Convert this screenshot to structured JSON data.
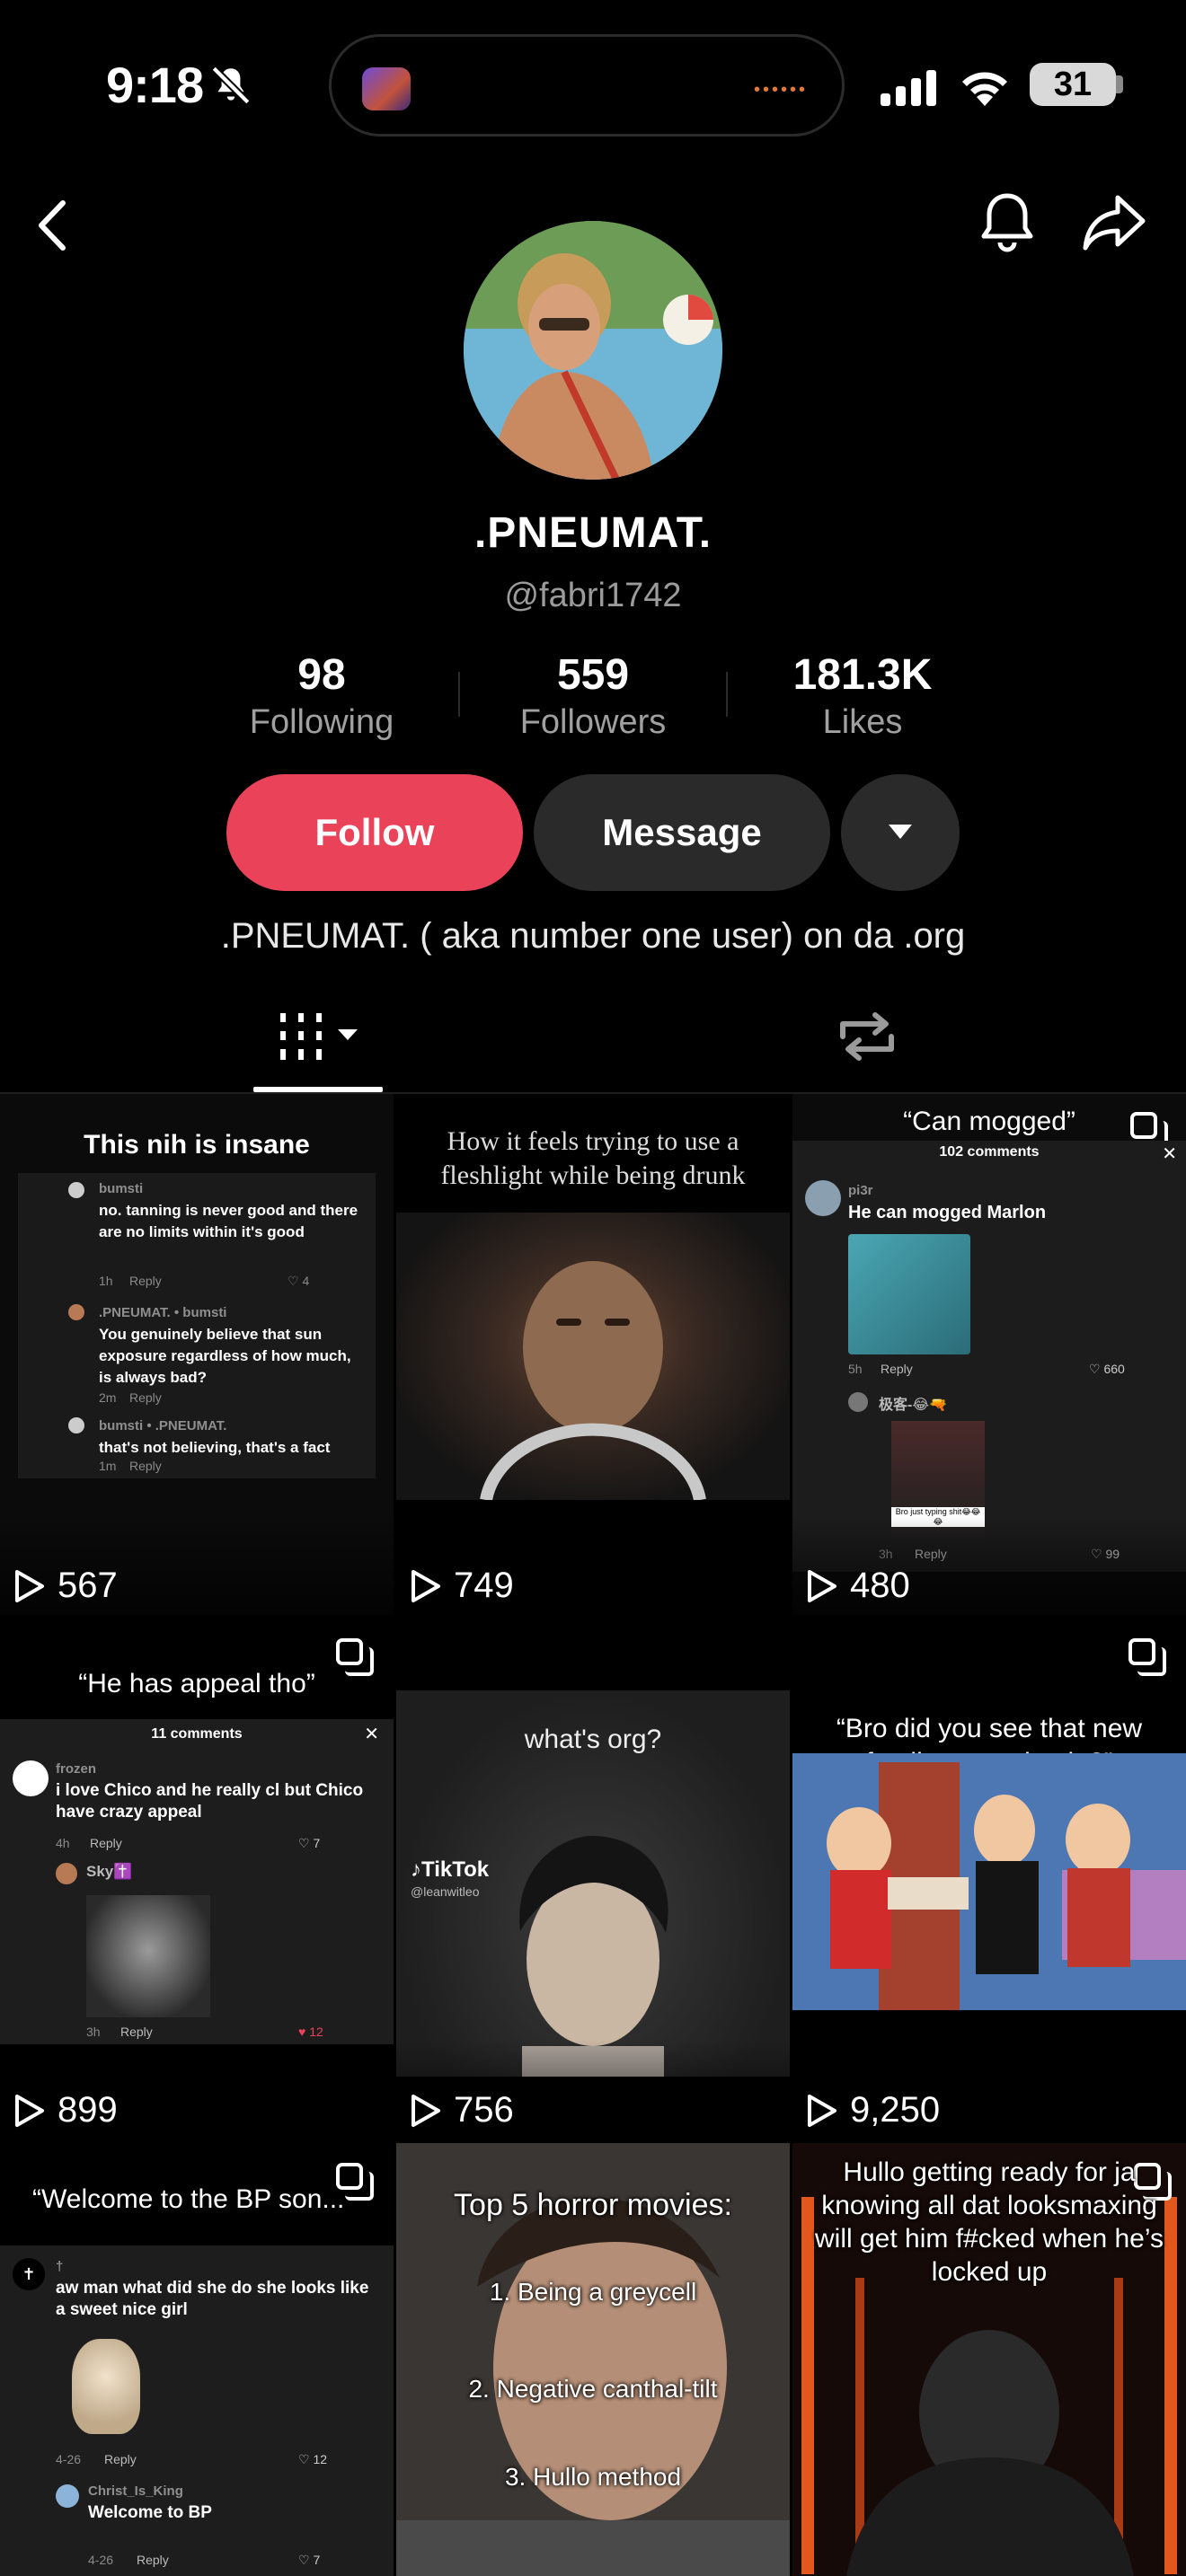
{
  "status_bar": {
    "time": "9:18",
    "battery": "31"
  },
  "profile": {
    "display_name": ".PNEUMAT.",
    "username": "@fabri1742",
    "following_count": "98",
    "following_label": "Following",
    "followers_count": "559",
    "followers_label": "Followers",
    "likes_count": "181.3K",
    "likes_label": "Likes",
    "follow_label": "Follow",
    "message_label": "Message",
    "bio": ".PNEUMAT. ( aka number one user) on da .org",
    "accent": "#ea4359"
  },
  "grid": {
    "tile1": {
      "caption": "This nih is insane",
      "comments": [
        {
          "user": "bumsti",
          "text": "no. tanning is never good and there are no limits within it's good",
          "time": "1h",
          "reply": "Reply",
          "likes": "4"
        },
        {
          "user": ".PNEUMAT. • bumsti",
          "text": "You genuinely believe that sun exposure regardless of how much, is always bad?",
          "time": "2m",
          "reply": "Reply"
        },
        {
          "user": "bumsti • .PNEUMAT.",
          "text": "that's not believing, that's a fact",
          "time": "1m",
          "reply": "Reply"
        }
      ],
      "views": "567"
    },
    "tile2": {
      "caption": "How it feels trying to use a fleshlight while being drunk",
      "views": "749"
    },
    "tile3": {
      "caption": "“Can mogged”",
      "comments_count": "102 comments",
      "comment_user": "pi3r",
      "comment_text": "He can mogged Marlon",
      "comment_time": "5h",
      "reply": "Reply",
      "likes1": "660",
      "reply_user": "极客-😂🔫",
      "reply_time": "3h",
      "likes2": "99",
      "sticker_text": "Bro just typing shit😂😂😂",
      "views": "480"
    },
    "tile4": {
      "caption": "“He has appeal tho”",
      "comments_count": "11 comments",
      "comment_user": "frozen",
      "comment_text": "i love Chico and he really cl but Chico have crazy appeal",
      "comment_time": "4h",
      "reply": "Reply",
      "likes1": "7",
      "reply_user": "Sky✝️",
      "reply_time": "3h",
      "likes2": "12",
      "views": "899"
    },
    "tile5": {
      "caption": "what's org?",
      "watermark": "TikTok",
      "handle": "@leanwitleo",
      "views": "756"
    },
    "tile6": {
      "caption": "“Bro did you see that new family guy episode?”",
      "views": "9,250"
    },
    "tile7": {
      "caption": "“Welcome to the BP son...",
      "comment_user": "†",
      "comment_text": "aw man what did she do she looks like a sweet nice girl",
      "comment_time": "4-26",
      "reply": "Reply",
      "likes1": "12",
      "reply_user": "Christ_Is_King",
      "reply_text": "Welcome to BP",
      "reply_time": "4-26",
      "likes2": "7"
    },
    "tile8": {
      "title": "Top 5 horror movies:",
      "items": [
        "1. Being a greycell",
        "2. Negative canthal-tilt",
        "3. Hullo method"
      ]
    },
    "tile9": {
      "caption": "Hullo getting ready for ja knowing all dat looksmaxing will get him f#cked when he’s locked up"
    }
  }
}
